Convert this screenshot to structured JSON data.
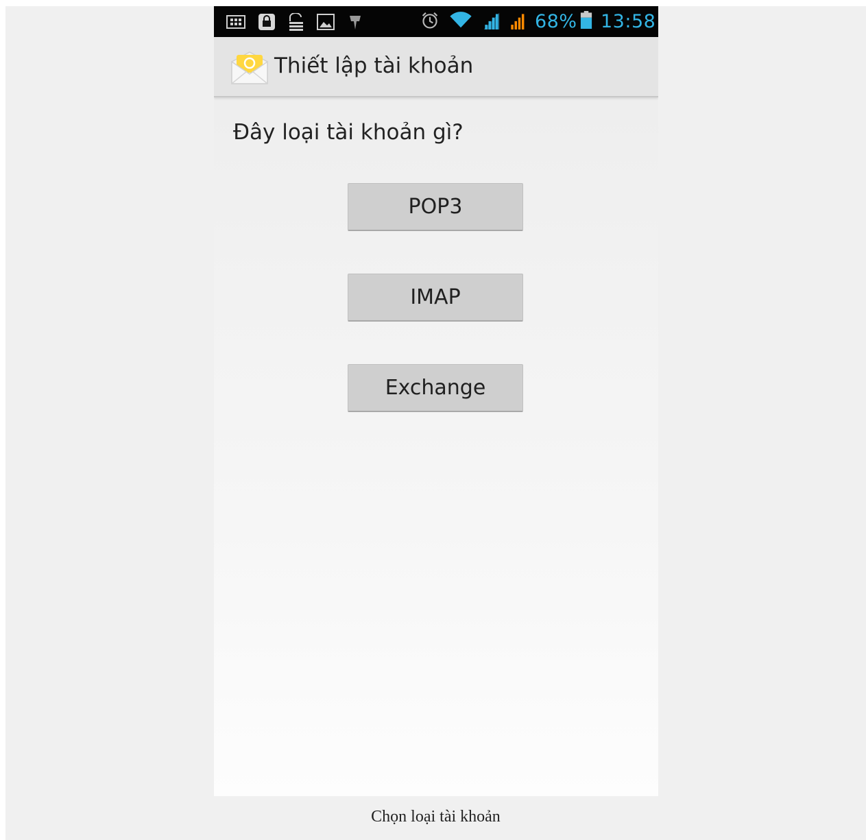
{
  "status_bar": {
    "icons": [
      "sd-card-icon",
      "lock-icon",
      "storage-icon",
      "image-icon",
      "usb-debug-icon",
      "alarm-icon",
      "wifi-icon",
      "signal-1-icon",
      "signal-2-icon",
      "battery-icon"
    ],
    "battery": "68%",
    "time": "13:58",
    "accent_color": "#33b5e5",
    "signal2_color": "#ff8a00"
  },
  "action_bar": {
    "icon": "email-envelope-icon",
    "title": "Thiết lập tài khoản"
  },
  "main": {
    "question": "Đây loại tài khoản gì?",
    "buttons": [
      {
        "label": "POP3"
      },
      {
        "label": "IMAP"
      },
      {
        "label": "Exchange"
      }
    ]
  },
  "caption": "Chọn loại tài khoản"
}
